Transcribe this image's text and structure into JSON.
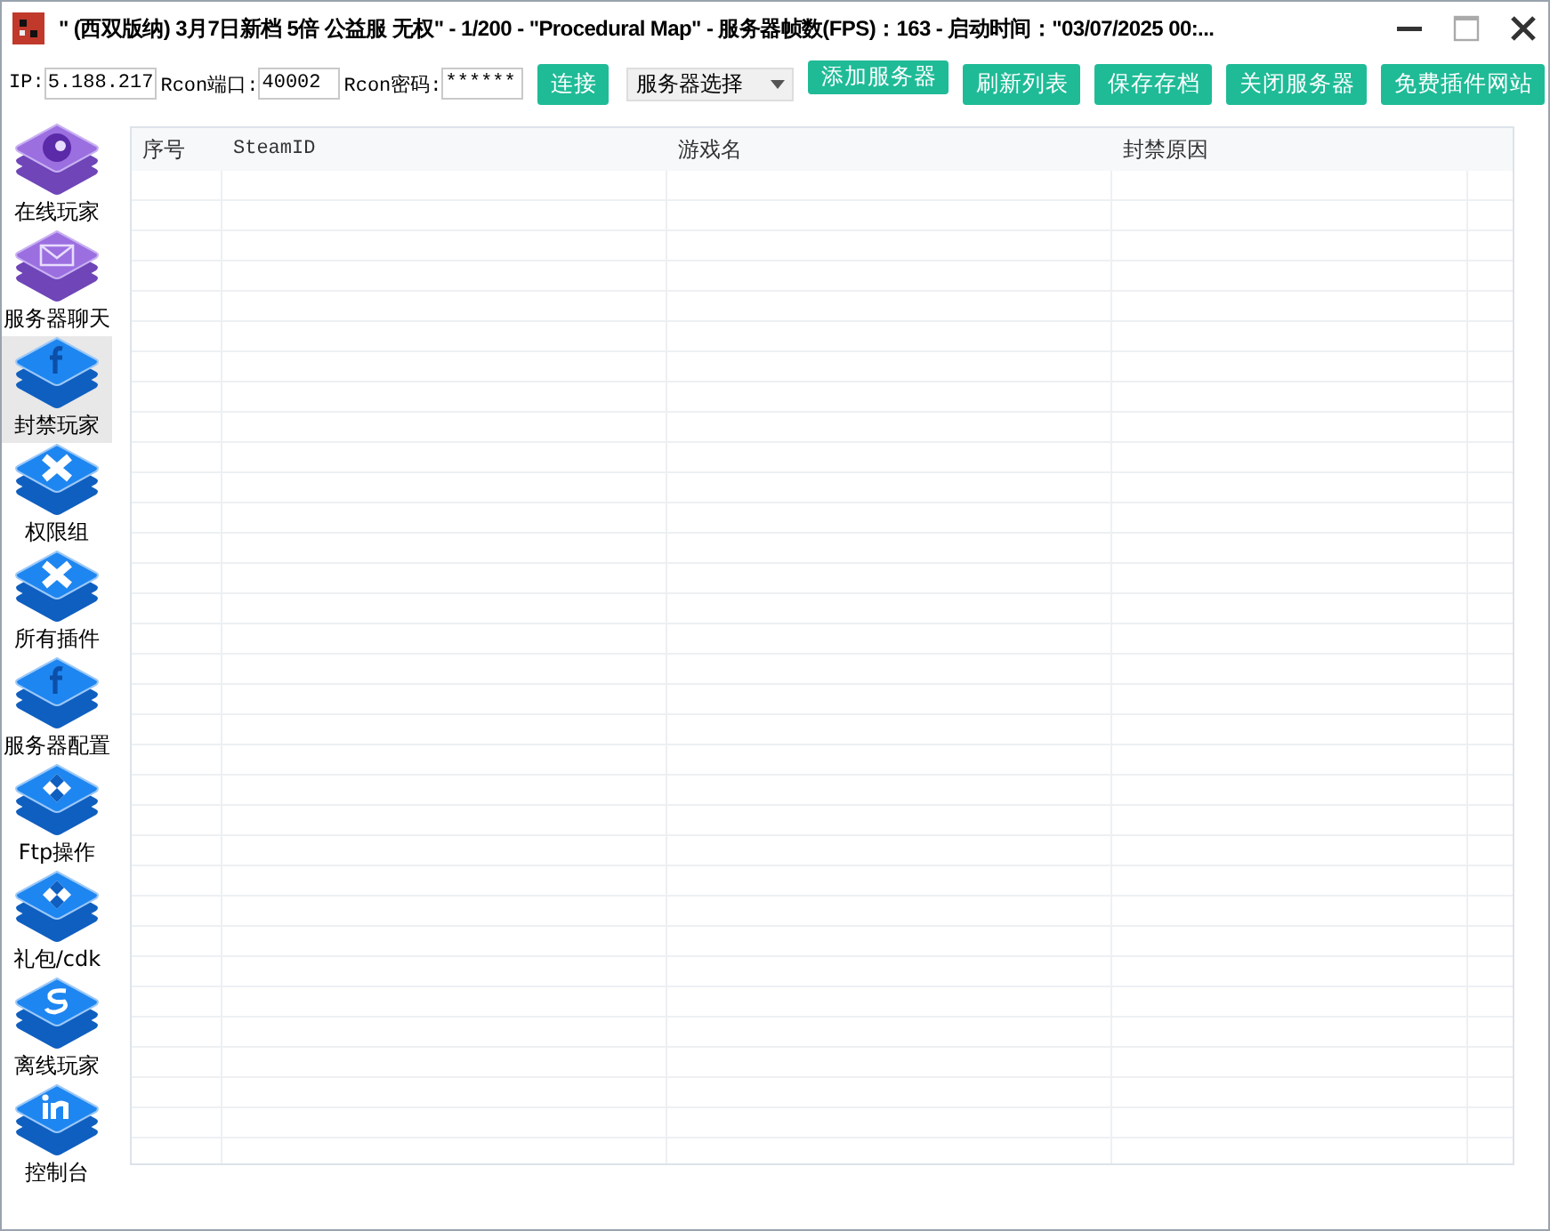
{
  "window": {
    "title": "\" (西双版纳) 3月7日新档 5倍 公益服  无权\"  -  1/200  -  \"Procedural Map\"  -  服务器帧数(FPS)：163  -  启动时间：\"03/07/2025 00:..."
  },
  "toolbar": {
    "fields": [
      {
        "label": "IP:",
        "value": "5.188.217"
      },
      {
        "label": "Rcon端口:",
        "value": "40002"
      },
      {
        "label": "Rcon密码:",
        "value": "******"
      }
    ],
    "connect_button": "连接",
    "server_select": "服务器选择",
    "buttons": [
      "添加服务器",
      "刷新列表",
      "保存存档",
      "关闭服务器",
      "免费插件网站"
    ]
  },
  "sidebar": {
    "items": [
      {
        "label": "在线玩家",
        "kind": "avatar",
        "selected": false
      },
      {
        "label": "服务器聊天",
        "kind": "mail",
        "selected": false
      },
      {
        "label": "封禁玩家",
        "kind": "f",
        "selected": true
      },
      {
        "label": "权限组",
        "kind": "cross",
        "selected": false
      },
      {
        "label": "所有插件",
        "kind": "cross",
        "selected": false
      },
      {
        "label": "服务器配置",
        "kind": "f",
        "selected": false
      },
      {
        "label": "Ftp操作",
        "kind": "grid",
        "selected": false
      },
      {
        "label": "礼包/cdk",
        "kind": "grid",
        "selected": false
      },
      {
        "label": "离线玩家",
        "kind": "s",
        "selected": false
      },
      {
        "label": "控制台",
        "kind": "in",
        "selected": false
      }
    ]
  },
  "table": {
    "columns": [
      "序号",
      "SteamID",
      "游戏名",
      "封禁原因"
    ]
  }
}
